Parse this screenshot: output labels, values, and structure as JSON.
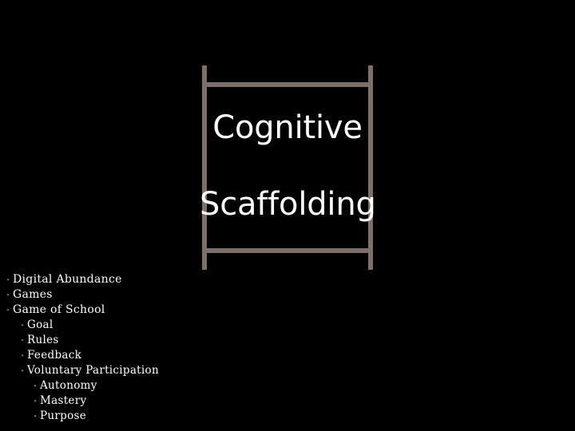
{
  "slide": {
    "background_color": "#000000",
    "ladder": {
      "name": "ladder-graphic",
      "rail_color": "#7c6f67",
      "rung_color": "#7c6f67",
      "rung_count": 2
    },
    "title": {
      "line1": "Cognitive",
      "line2": "Scaffolding",
      "color": "#ffffff"
    },
    "bullets": [
      {
        "level": 1,
        "marker": "•",
        "label": "Digital Abundance"
      },
      {
        "level": 1,
        "marker": "•",
        "label": "Games"
      },
      {
        "level": 1,
        "marker": "•",
        "label": "Game of School"
      },
      {
        "level": 2,
        "marker": "•",
        "label": "Goal"
      },
      {
        "level": 2,
        "marker": "•",
        "label": "Rules"
      },
      {
        "level": 2,
        "marker": "•",
        "label": "Feedback"
      },
      {
        "level": 2,
        "marker": "•",
        "label": "Voluntary Participation"
      },
      {
        "level": 3,
        "marker": "•",
        "label": "Autonomy"
      },
      {
        "level": 3,
        "marker": "•",
        "label": "Mastery"
      },
      {
        "level": 3,
        "marker": "•",
        "label": "Purpose"
      }
    ],
    "bullet_color": "#7a6242",
    "text_color": "#ffffff"
  }
}
